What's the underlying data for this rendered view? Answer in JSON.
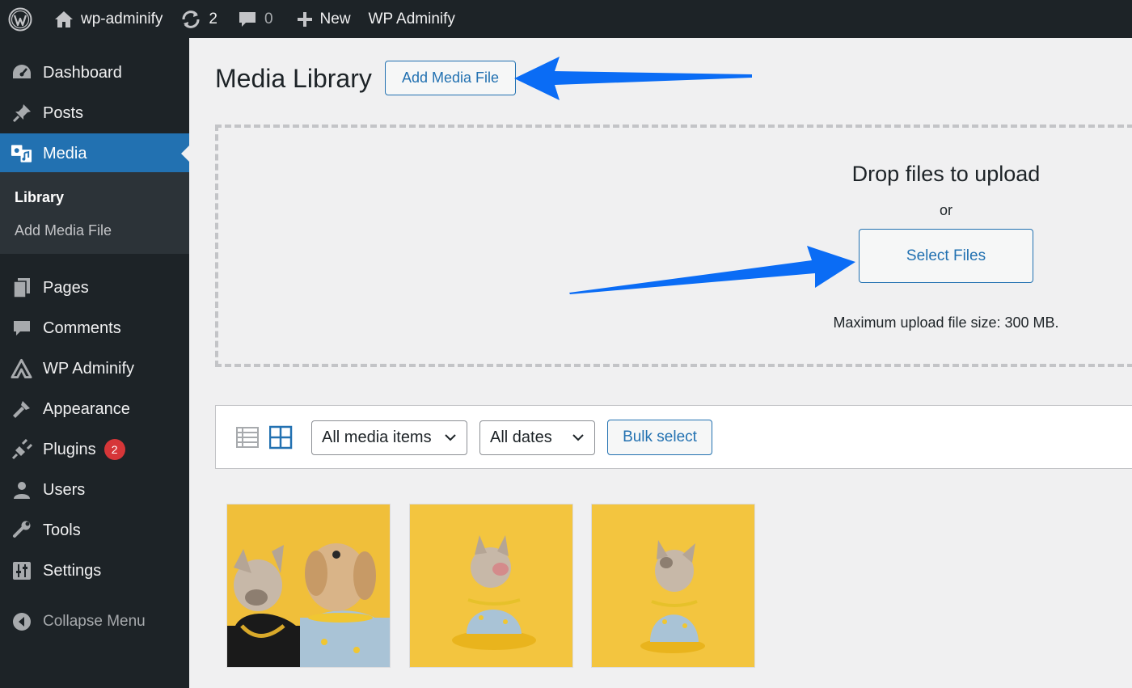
{
  "adminbar": {
    "site_name": "wp-adminify",
    "updates_count": "2",
    "comments_count": "0",
    "new_label": "New",
    "plugin_label": "WP Adminify"
  },
  "sidebar": {
    "items": [
      {
        "label": "Dashboard",
        "icon": "dashboard-icon"
      },
      {
        "label": "Posts",
        "icon": "pin-icon"
      },
      {
        "label": "Media",
        "icon": "media-icon"
      },
      {
        "label": "Pages",
        "icon": "pages-icon"
      },
      {
        "label": "Comments",
        "icon": "comment-icon"
      },
      {
        "label": "WP Adminify",
        "icon": "adminify-icon"
      },
      {
        "label": "Appearance",
        "icon": "brush-icon"
      },
      {
        "label": "Plugins",
        "icon": "plugin-icon",
        "badge": "2"
      },
      {
        "label": "Users",
        "icon": "user-icon"
      },
      {
        "label": "Tools",
        "icon": "wrench-icon"
      },
      {
        "label": "Settings",
        "icon": "settings-icon"
      }
    ],
    "submenu": [
      "Library",
      "Add Media File"
    ],
    "collapse_label": "Collapse Menu"
  },
  "main": {
    "title": "Media Library",
    "add_button": "Add Media File",
    "uploader": {
      "title": "Drop files to upload",
      "or": "or",
      "select_button": "Select Files",
      "max_size": "Maximum upload file size: 300 MB."
    },
    "toolbar": {
      "filter_type": "All media items",
      "filter_date": "All dates",
      "bulk_select": "Bulk select"
    }
  },
  "colors": {
    "adminbar_bg": "#1d2327",
    "accent": "#2271b1",
    "annotation_arrow": "#0a6cf5",
    "badge": "#d63638"
  }
}
